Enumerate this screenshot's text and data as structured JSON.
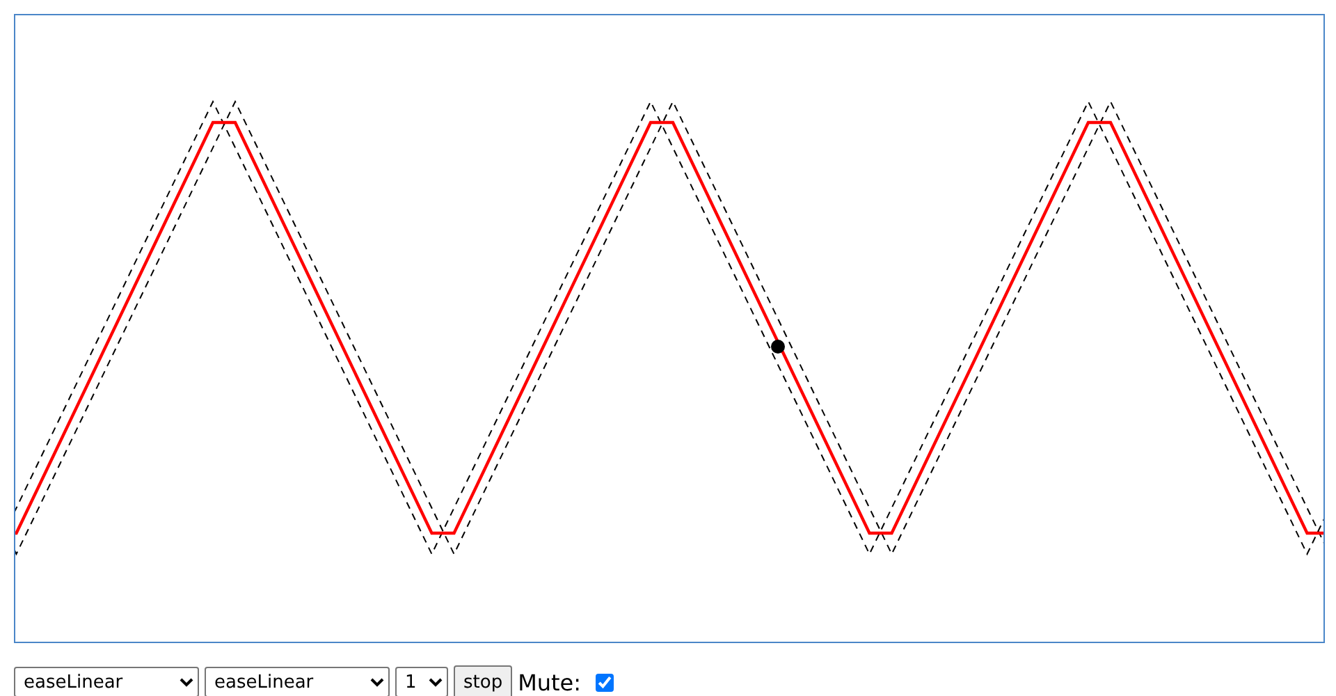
{
  "controls": {
    "ease_in": {
      "value": "easeLinear"
    },
    "ease_out": {
      "value": "easeLinear"
    },
    "count": {
      "value": "1"
    },
    "button": "stop",
    "mute": {
      "label": "Mute:",
      "checked": true
    }
  }
}
